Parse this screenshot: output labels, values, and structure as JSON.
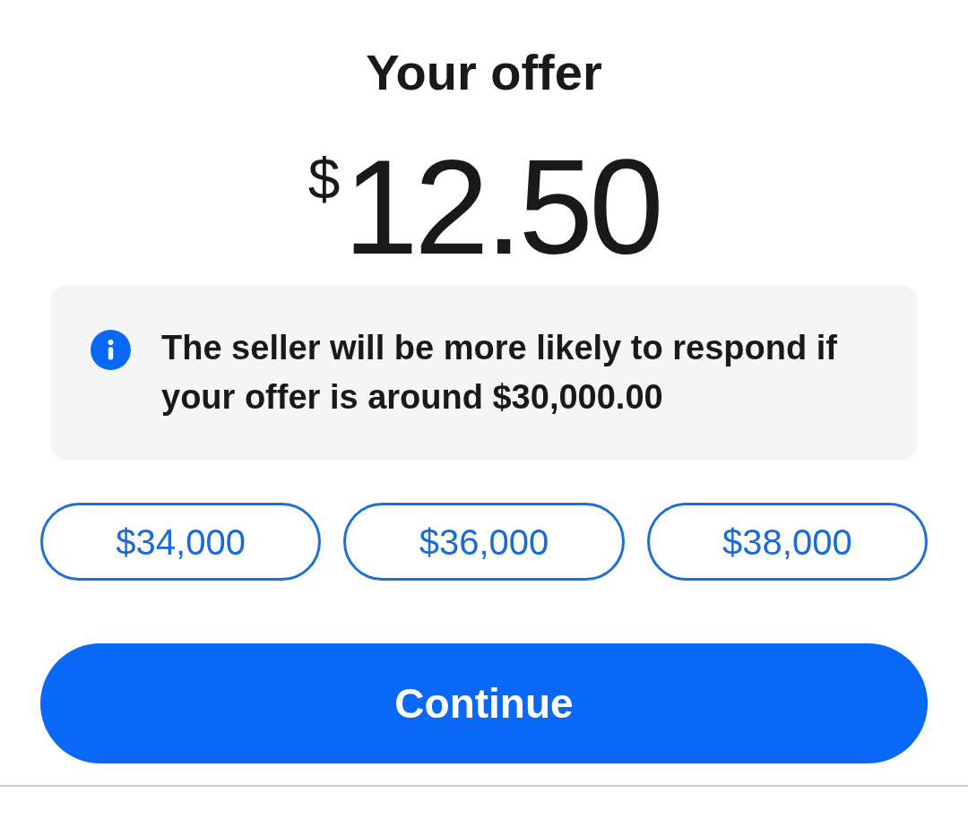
{
  "title": "Your offer",
  "offer_amount": {
    "currency_symbol": "$",
    "value": "12.50"
  },
  "hint": {
    "text": "The seller will be more likely to respond if your offer is around $30,000.00"
  },
  "suggested_offers": [
    {
      "label": "$34,000",
      "selected": false
    },
    {
      "label": "$36,000",
      "selected": false
    },
    {
      "label": "$38,000",
      "selected": false
    }
  ],
  "primary_button": {
    "label": "Continue"
  }
}
